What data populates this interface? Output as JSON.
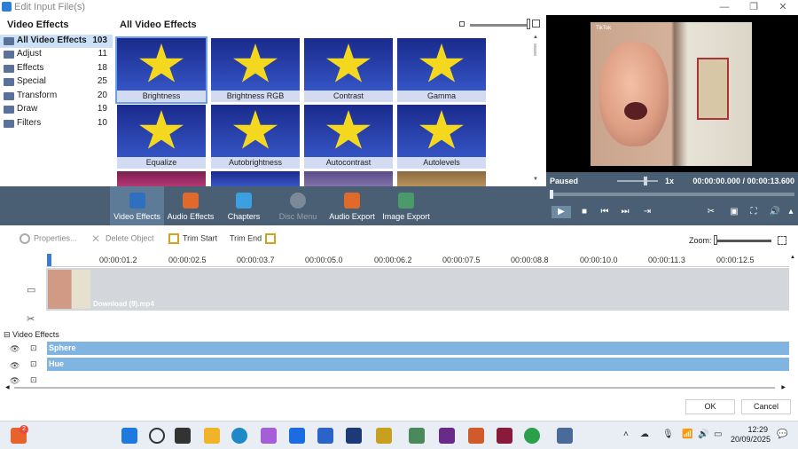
{
  "window": {
    "title": "Edit Input File(s)"
  },
  "categories": {
    "header": "Video Effects",
    "items": [
      {
        "label": "All Video Effects",
        "count": "103"
      },
      {
        "label": "Adjust",
        "count": "11"
      },
      {
        "label": "Effects",
        "count": "18"
      },
      {
        "label": "Special",
        "count": "25"
      },
      {
        "label": "Transform",
        "count": "20"
      },
      {
        "label": "Draw",
        "count": "19"
      },
      {
        "label": "Filters",
        "count": "10"
      }
    ]
  },
  "effects_grid": {
    "header": "All Video Effects",
    "tiles": [
      "Brightness",
      "Brightness RGB",
      "Contrast",
      "Gamma",
      "Equalize",
      "Autobrightness",
      "Autocontrast",
      "Autolevels"
    ]
  },
  "toolbar": {
    "items": [
      "Video Effects",
      "Audio Effects",
      "Chapters",
      "Disc Menu",
      "Audio Export",
      "Image Export"
    ]
  },
  "player": {
    "status": "Paused",
    "speed": "1x",
    "time": "00:00:00.000 / 00:00:13.600",
    "video_tag": "TikTok"
  },
  "timeline_tools": {
    "properties": "Properties...",
    "delete_object": "Delete Object",
    "trim_start": "Trim Start",
    "trim_end": "Trim End",
    "zoom": "Zoom:"
  },
  "ruler": {
    "ticks": [
      "00:00:01.2",
      "00:00:02.5",
      "00:00:03.7",
      "00:00:05.0",
      "00:00:06.2",
      "00:00:07.5",
      "00:00:08.8",
      "00:00:10.0",
      "00:00:11.3",
      "00:00:12.5"
    ]
  },
  "tracks": {
    "clip_name": "Download (9).mp4",
    "fx_header": "Video Effects",
    "fx_rows": [
      "Sphere",
      "Hue"
    ]
  },
  "dialog": {
    "ok": "OK",
    "cancel": "Cancel"
  },
  "taskbar": {
    "notification_count": "2",
    "time": "12:29",
    "date": "20/09/2025"
  }
}
